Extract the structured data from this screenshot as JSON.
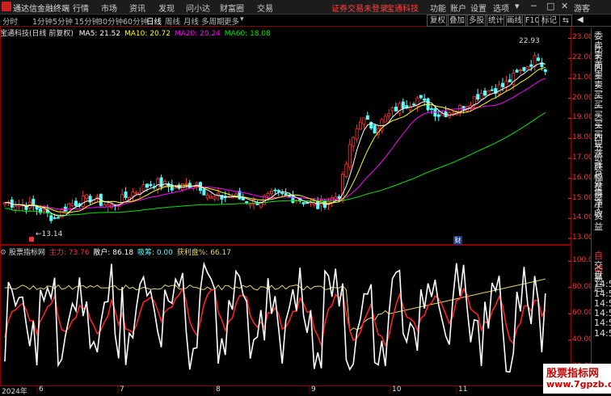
{
  "app": {
    "title": "通达信金融终端"
  },
  "menu": [
    "行情",
    "市场",
    "资讯",
    "发现",
    "问小达",
    "财富圈",
    "交易"
  ],
  "status": {
    "login": "证券交易未登录",
    "stock": "宝通科技"
  },
  "right_menu": [
    "功能",
    "账户",
    "设置",
    "选项",
    "游客"
  ],
  "periods": [
    "分时",
    "1分钟",
    "5分钟",
    "15分钟",
    "30分钟",
    "60分钟",
    "日线",
    "周线",
    "月线",
    "多周期",
    "更多"
  ],
  "selected_period": "日线",
  "tools": [
    "复权",
    "叠加",
    "多股",
    "统计",
    "画线",
    "F10",
    "标记"
  ],
  "stock_info": {
    "name": "宝通科技(日线 前复权)",
    "ma5": "MA5: 21.52",
    "ma10": "MA10: 20.72",
    "ma20": "MA20: 20.24",
    "ma60": "MA60: 18.08"
  },
  "annotations": {
    "high": "22.93",
    "low": "13.14",
    "cai": "财"
  },
  "indicator": {
    "name": "股票指标网",
    "zhuli": "主力: 73.76",
    "sanhu": "散户: 86.18",
    "xishou": "吸筹: 0.00",
    "huoli": "获利盘%: 66.17"
  },
  "price_axis": [
    "23.00",
    "22.00",
    "21.00",
    "20.00",
    "19.00",
    "18.00",
    "17.00",
    "16.00",
    "15.00",
    "14.00",
    "13.00"
  ],
  "ind_axis": [
    "100.0",
    "80.00",
    "60.00",
    "40.00",
    "20.00"
  ],
  "date_axis": {
    "year": "2024年",
    "months": [
      "6",
      "7",
      "8",
      "9",
      "10",
      "11"
    ]
  },
  "right_panel": {
    "quote": [
      "委比",
      "卖五",
      "卖四",
      "卖三",
      "卖二",
      "卖一",
      "买一",
      "买二",
      "买三",
      "买四",
      "买五",
      "现价",
      "涨跌",
      "涨幅",
      "总量",
      "外盘",
      "换手",
      "净资",
      "收益"
    ],
    "lower": [
      "自动",
      "交易",
      "盘后",
      "14:5",
      "14:5",
      "14:5",
      "14:5",
      "14:5",
      "14:5"
    ]
  },
  "watermark": {
    "title": "股票指标网",
    "url": "www.7gpzb.com"
  },
  "colors": {
    "up": "#ff3232",
    "down": "#54ffff",
    "ma5": "#ffffff",
    "ma10": "#ffff00",
    "ma20": "#ff00ff",
    "ma60": "#00e600"
  }
}
